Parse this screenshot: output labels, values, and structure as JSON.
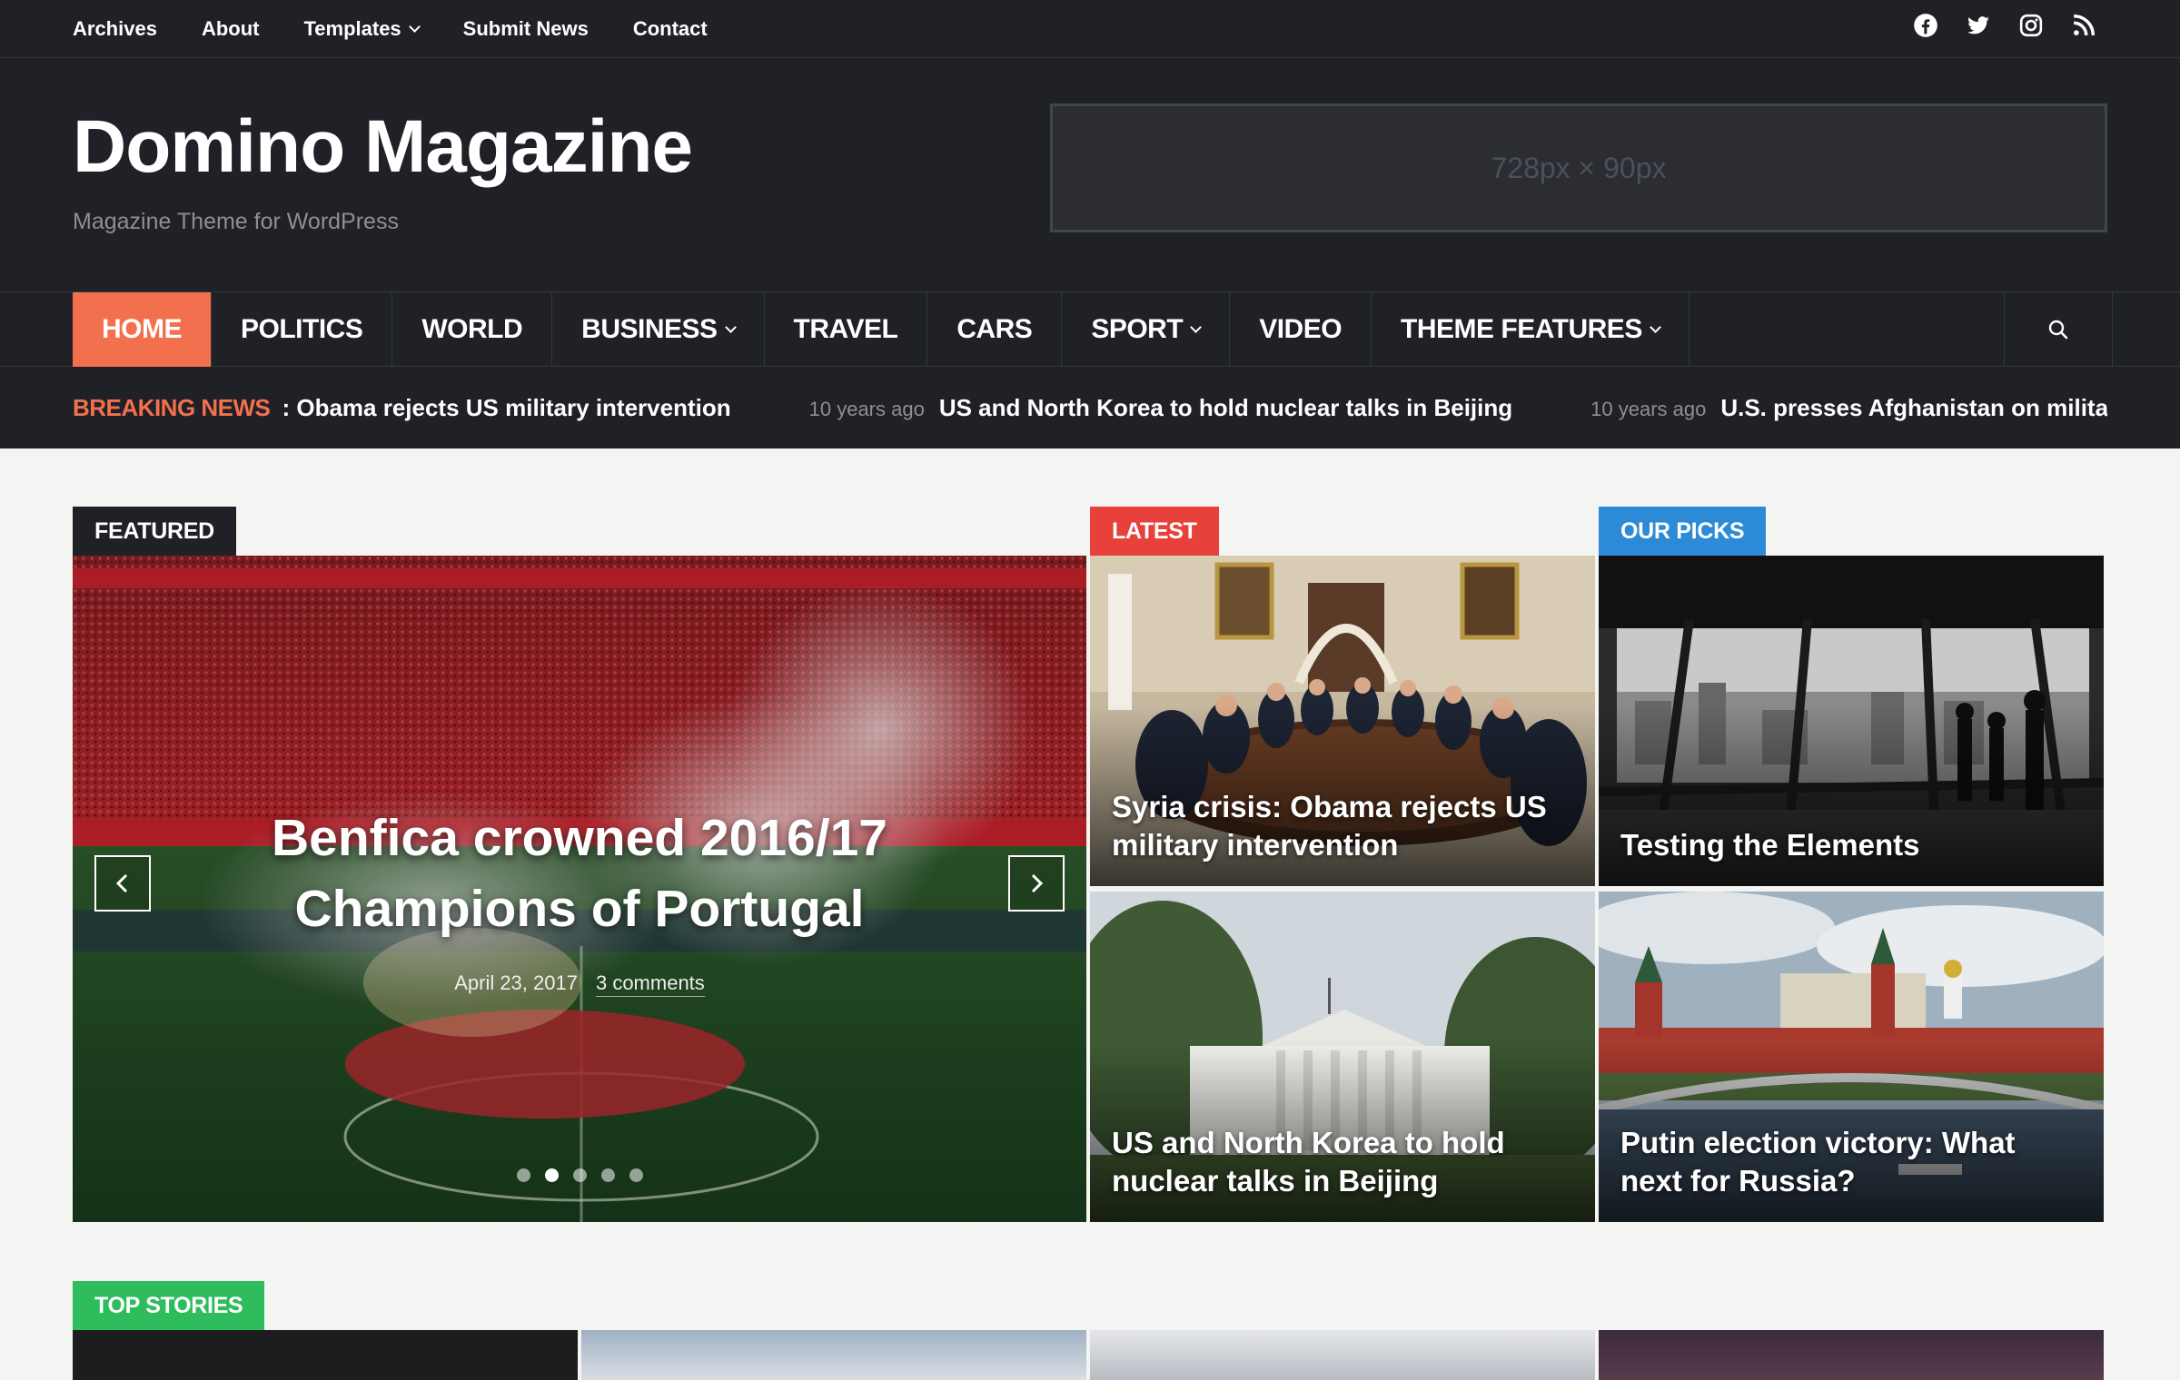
{
  "topnav": {
    "items": [
      "Archives",
      "About",
      "Templates",
      "Submit News",
      "Contact"
    ]
  },
  "social_icons": [
    "facebook-icon",
    "twitter-icon",
    "instagram-icon",
    "rss-icon"
  ],
  "site": {
    "title": "Domino Magazine",
    "tagline": "Magazine Theme for WordPress"
  },
  "ad": {
    "label": "728px × 90px"
  },
  "mainnav": {
    "items": [
      "HOME",
      "POLITICS",
      "WORLD",
      "BUSINESS",
      "TRAVEL",
      "CARS",
      "SPORT",
      "VIDEO",
      "THEME FEATURES"
    ]
  },
  "ticker": {
    "label": "BREAKING NEWS",
    "items": [
      {
        "time": "",
        "title": "Syria crisis: Obama rejects US military intervention"
      },
      {
        "time": "10 years ago",
        "title": "US and North Korea to hold nuclear talks in Beijing"
      },
      {
        "time": "10 years ago",
        "title": "U.S. presses Afghanistan on militant"
      }
    ]
  },
  "sections": {
    "featured": "FEATURED",
    "latest": "LATEST",
    "our_picks": "OUR PICKS",
    "top_stories": "TOP STORIES"
  },
  "colors": {
    "accent": "#f2704e",
    "latest": "#e8403b",
    "picks": "#2c8ad6",
    "top_stories": "#2ebc5c",
    "header_bg": "#1f2127"
  },
  "slider": {
    "title": "Benfica crowned 2016/17 Champions of Portugal",
    "date": "April 23, 2017",
    "comments": "3 comments",
    "slide_count": 5,
    "active_slide": 2
  },
  "tiles": {
    "latest_1": "Syria crisis: Obama rejects US military intervention",
    "latest_2": "US and North Korea to hold nuclear talks in Beijing",
    "picks_1": "Testing the Elements",
    "picks_2": "Putin election victory: What next for Russia?"
  }
}
